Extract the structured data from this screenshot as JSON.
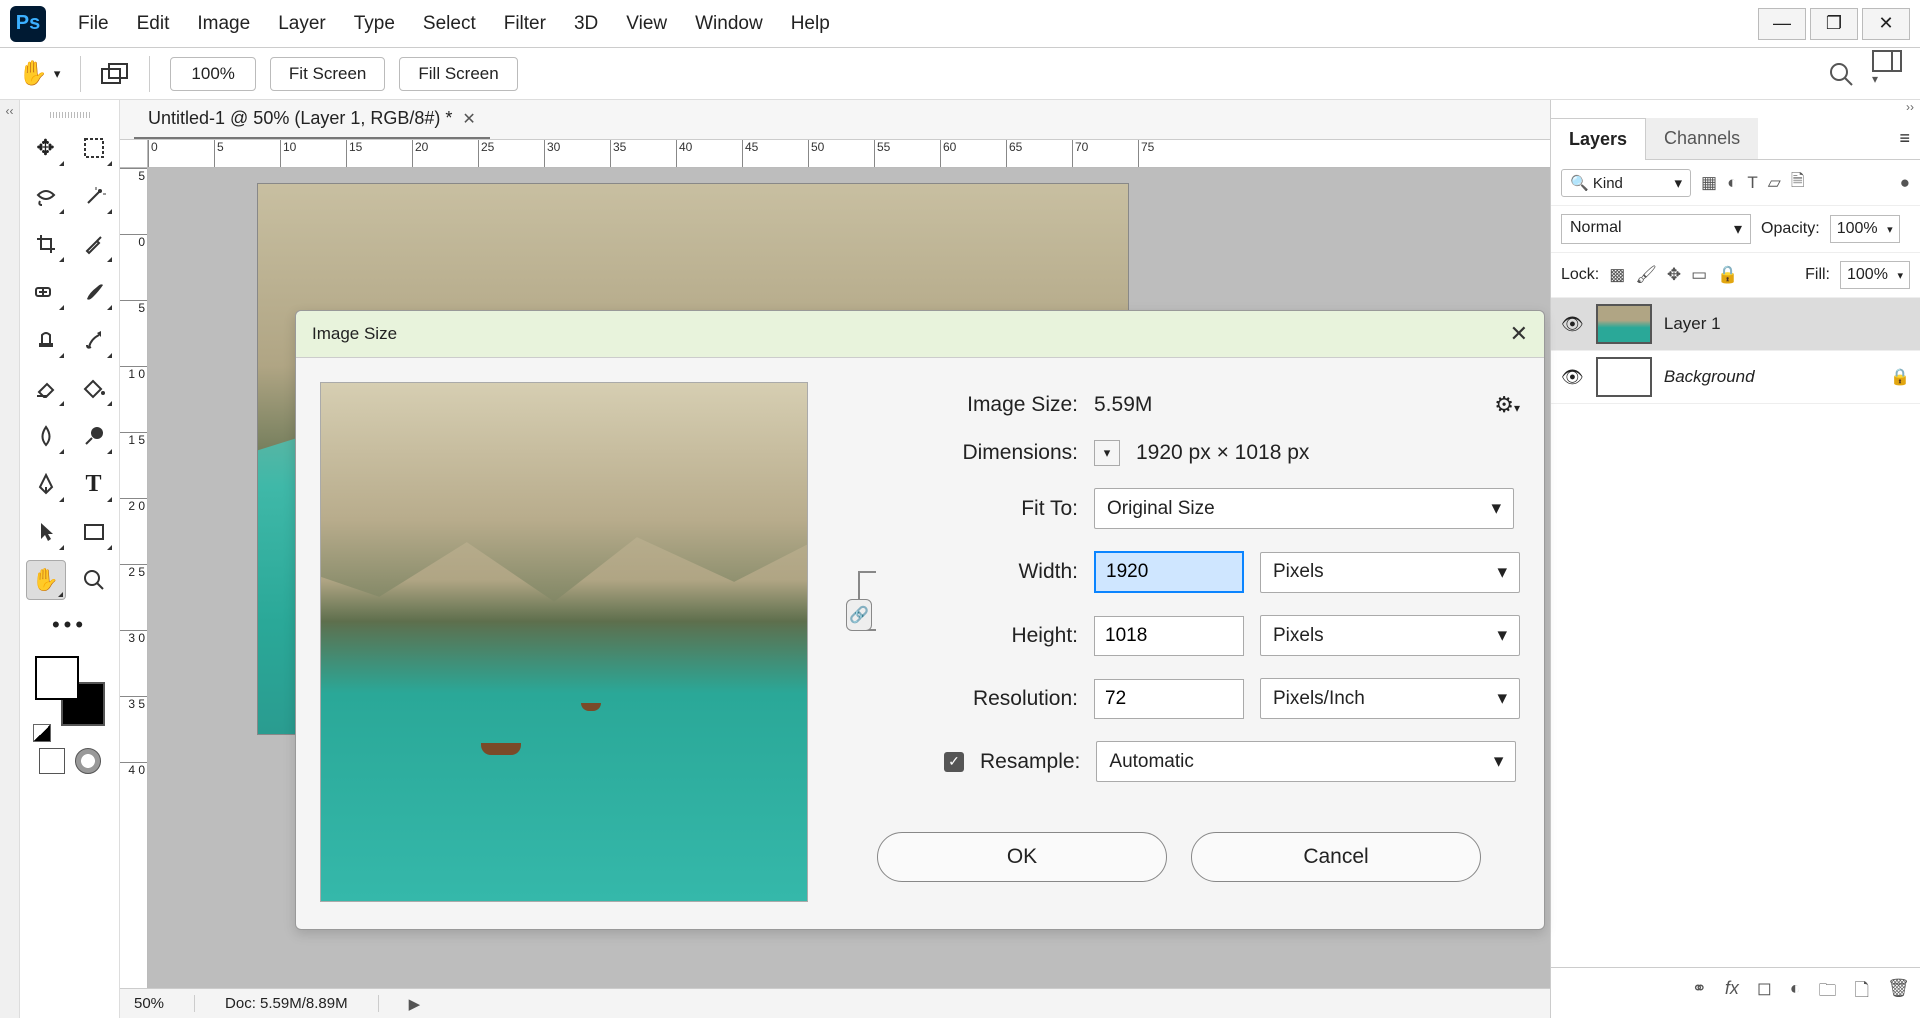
{
  "menubar": {
    "items": [
      "File",
      "Edit",
      "Image",
      "Layer",
      "Type",
      "Select",
      "Filter",
      "3D",
      "View",
      "Window",
      "Help"
    ]
  },
  "optionsbar": {
    "zoom": "100%",
    "fit_screen": "Fit Screen",
    "fill_screen": "Fill Screen"
  },
  "document": {
    "tab_title": "Untitled-1 @ 50% (Layer 1, RGB/8#) *",
    "ruler_h": [
      "0",
      "5",
      "10",
      "15",
      "20",
      "25",
      "30",
      "35",
      "40",
      "45",
      "50",
      "55",
      "60",
      "65",
      "70",
      "75"
    ],
    "ruler_v": [
      "5",
      "0",
      "5",
      "1\n0",
      "1\n5",
      "2\n0",
      "2\n5",
      "3\n0",
      "3\n5",
      "4\n0"
    ]
  },
  "statusbar": {
    "zoom": "50%",
    "doc": "Doc: 5.59M/8.89M"
  },
  "layers_panel": {
    "tabs": {
      "layers": "Layers",
      "channels": "Channels"
    },
    "kind": "Kind",
    "blend": "Normal",
    "opacity_label": "Opacity:",
    "opacity_val": "100%",
    "lock_label": "Lock:",
    "fill_label": "Fill:",
    "fill_val": "100%",
    "layers": [
      {
        "name": "Layer 1",
        "bg": false
      },
      {
        "name": "Background",
        "bg": true
      }
    ]
  },
  "dialog": {
    "title": "Image Size",
    "size_label": "Image Size:",
    "size_val": "5.59M",
    "dim_label": "Dimensions:",
    "dim_val": "1920 px  ×  1018 px",
    "fit_label": "Fit To:",
    "fit_val": "Original Size",
    "width_label": "Width:",
    "width_val": "1920",
    "width_unit": "Pixels",
    "height_label": "Height:",
    "height_val": "1018",
    "height_unit": "Pixels",
    "res_label": "Resolution:",
    "res_val": "72",
    "res_unit": "Pixels/Inch",
    "resample_label": "Resample:",
    "resample_val": "Automatic",
    "ok": "OK",
    "cancel": "Cancel"
  }
}
